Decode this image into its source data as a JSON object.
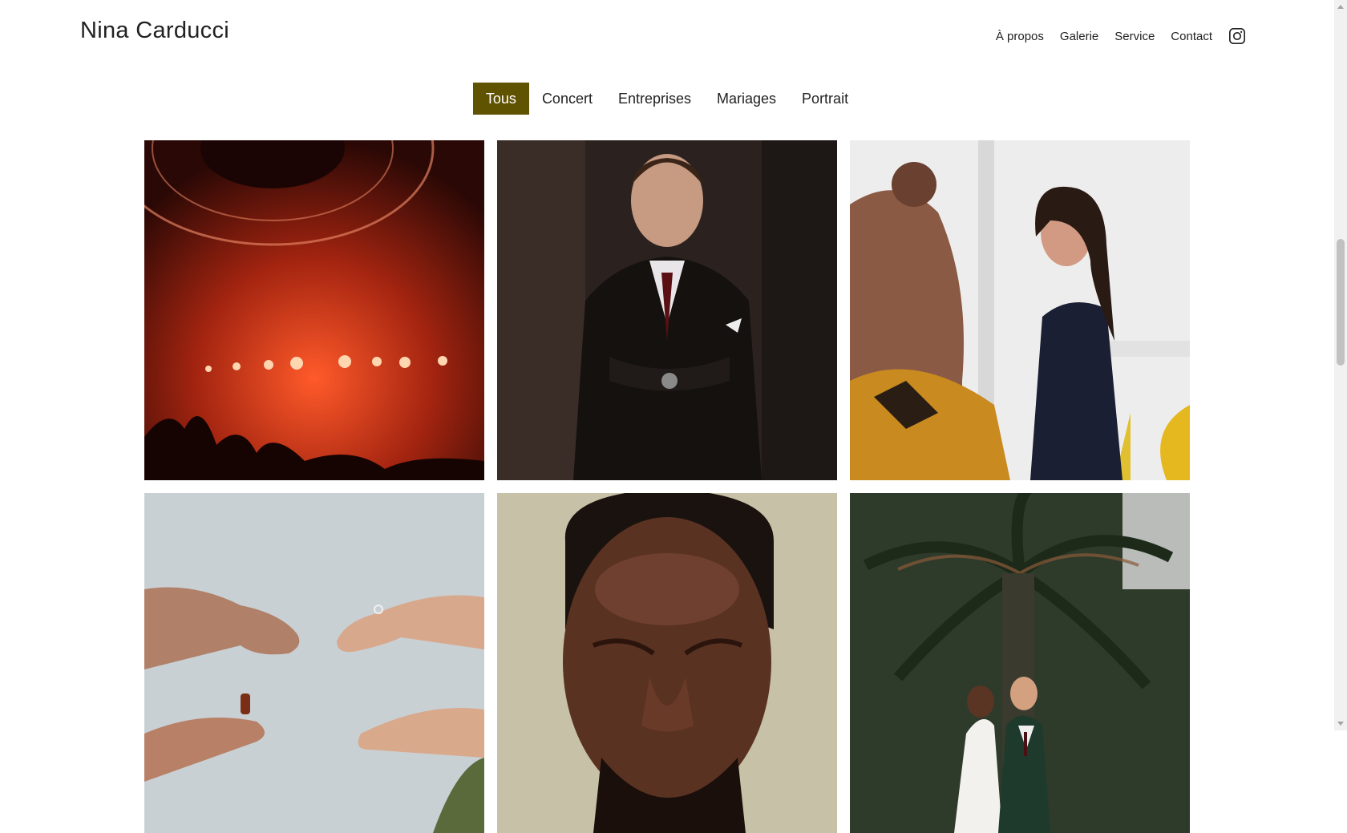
{
  "header": {
    "brand": "Nina Carducci",
    "nav": [
      "À propos",
      "Galerie",
      "Service",
      "Contact"
    ],
    "social_icon": "instagram-icon"
  },
  "filters": {
    "items": [
      "Tous",
      "Concert",
      "Entreprises",
      "Mariages",
      "Portrait"
    ],
    "active": "Tous",
    "active_color": "#5f5200"
  },
  "gallery": {
    "items": [
      {
        "category": "Concert",
        "subject": "concert stage lights"
      },
      {
        "category": "Entreprises",
        "subject": "man in suit arms crossed"
      },
      {
        "category": "Entreprises",
        "subject": "smiling woman in office"
      },
      {
        "category": "Mariages",
        "subject": "hands with ring"
      },
      {
        "category": "Portrait",
        "subject": "man closing eyes"
      },
      {
        "category": "Mariages",
        "subject": "couple under palm tree"
      }
    ]
  }
}
